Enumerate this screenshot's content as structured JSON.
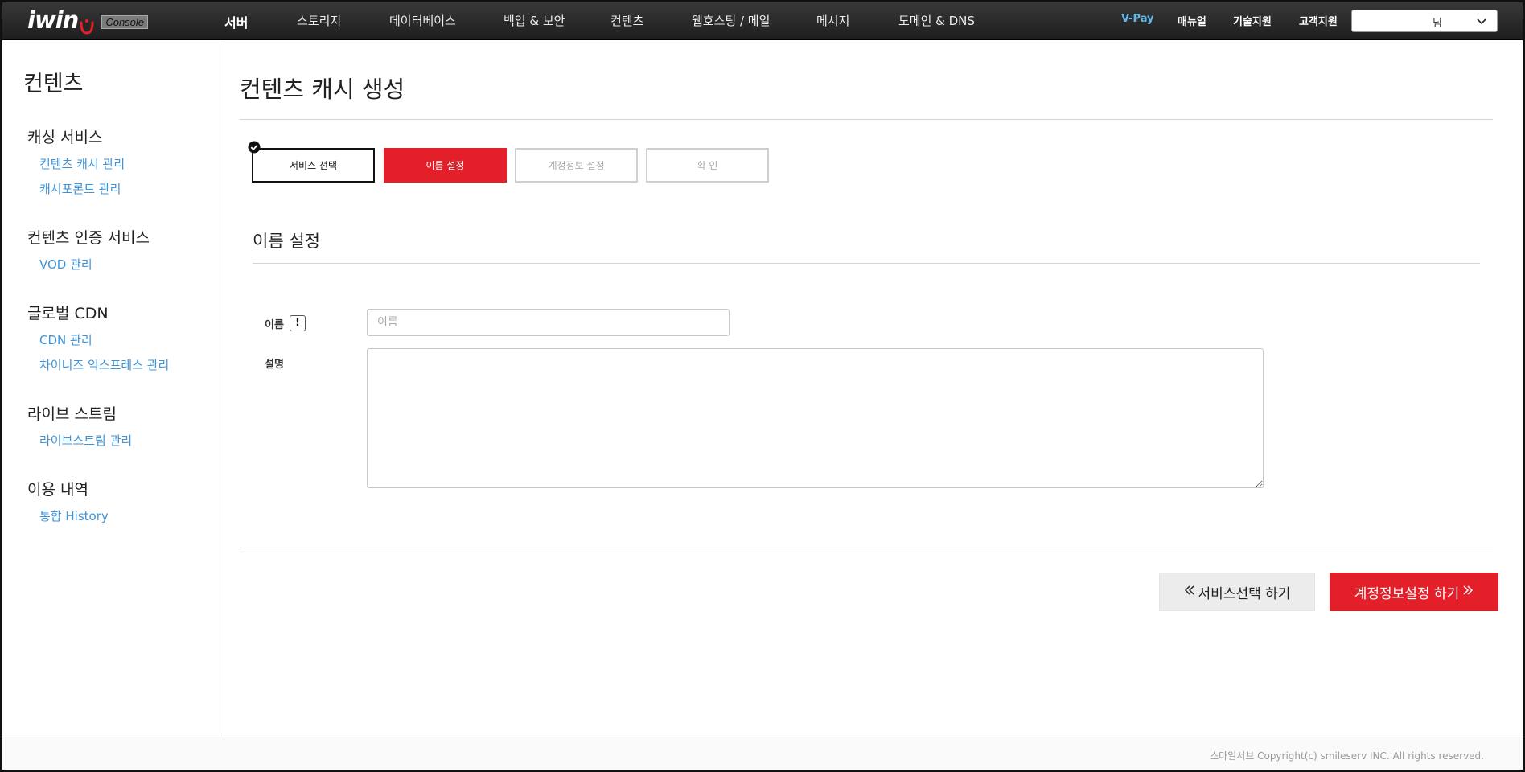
{
  "app": {
    "logo_text": "iwin",
    "logo_badge": "Console"
  },
  "nav": {
    "main": [
      "서버",
      "스토리지",
      "데이터베이스",
      "백업 & 보안",
      "컨텐츠",
      "웹호스팅 / 메일",
      "메시지",
      "도메인 & DNS"
    ],
    "right": [
      "V-Pay",
      "매뉴얼",
      "기술지원",
      "고객지원"
    ],
    "user_suffix": "님"
  },
  "sidebar": {
    "title": "컨텐츠",
    "groups": [
      {
        "title": "캐싱 서비스",
        "links": [
          "컨텐츠 캐시 관리",
          "캐시포론트 관리"
        ]
      },
      {
        "title": "컨텐츠 인증 서비스",
        "links": [
          "VOD 관리"
        ]
      },
      {
        "title": "글로벌 CDN",
        "links": [
          "CDN 관리",
          "차이니즈 익스프레스 관리"
        ]
      },
      {
        "title": "라이브 스트림",
        "links": [
          "라이브스트림 관리"
        ]
      },
      {
        "title": "이용 내역",
        "links": [
          "통합 History"
        ]
      }
    ]
  },
  "main": {
    "page_title": "컨텐츠 캐시 생성",
    "steps": [
      {
        "label": "서비스 선택",
        "state": "done"
      },
      {
        "label": "이름 설정",
        "state": "active"
      },
      {
        "label": "계정정보 설정",
        "state": "todo"
      },
      {
        "label": "확  인",
        "state": "todo"
      }
    ],
    "section_title": "이름 설정",
    "form": {
      "name_label": "이름",
      "name_placeholder": "이름",
      "name_value": "",
      "desc_label": "설명",
      "desc_value": ""
    },
    "buttons": {
      "prev": "서비스선택 하기",
      "next": "계정정보설정 하기"
    }
  },
  "footer": {
    "copyright": "스마일서브 Copyright(c) smileserv INC. All rights reserved."
  },
  "colors": {
    "accent": "#e3202a",
    "link": "#3d93d8",
    "vpay": "#66b7ea",
    "topbar": "#2a2a2a"
  }
}
